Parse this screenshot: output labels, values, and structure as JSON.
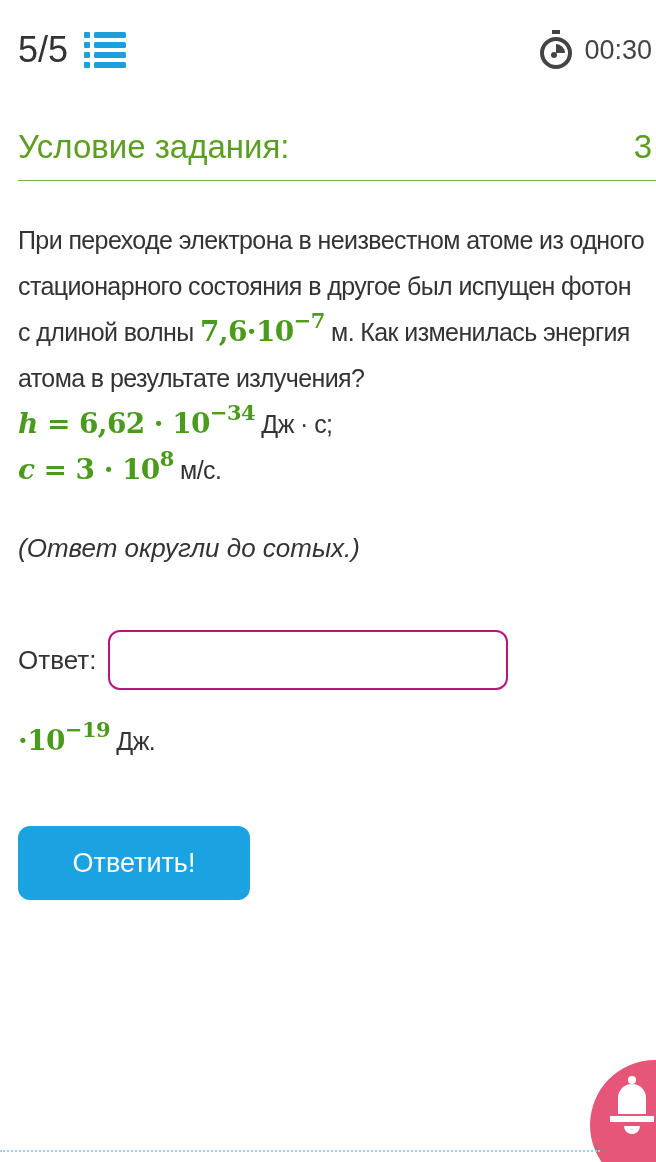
{
  "header": {
    "progress": "5/5",
    "timer": "00:30"
  },
  "task": {
    "heading": "Условие задания:",
    "points": "3",
    "paragraphs": [
      [
        {
          "kind": "text",
          "text": "При переходе электрона в неизвестном атоме из одного стационарного состояния в другое был испущен фотон с длиной волны "
        },
        {
          "kind": "math",
          "text": "7,6·10",
          "sup": "−7"
        },
        {
          "kind": "text",
          "text": " м. Как изменилась энергия атома в результате излучения?"
        }
      ],
      [
        {
          "kind": "var",
          "text": "h"
        },
        {
          "kind": "math",
          "text": " = 6,62 · 10",
          "sup": "−34"
        },
        {
          "kind": "text",
          "text": " Дж · с;"
        }
      ],
      [
        {
          "kind": "var",
          "text": "c"
        },
        {
          "kind": "math",
          "text": " = 3 · 10",
          "sup": "8"
        },
        {
          "kind": "text",
          "text": " м/с."
        }
      ]
    ],
    "note": "(Ответ округли до сотых.)"
  },
  "answer": {
    "label": "Ответ:",
    "unit": [
      {
        "kind": "math",
        "text": "·10",
        "sup": "−19"
      },
      {
        "kind": "text",
        "text": " Дж."
      }
    ]
  },
  "submit": "Ответить!"
}
